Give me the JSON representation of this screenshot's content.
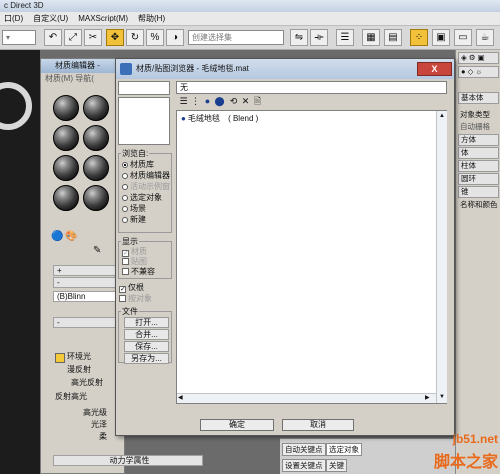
{
  "app": {
    "title": "c Direct 3D"
  },
  "menubar": [
    "口(D)",
    "自定义(U)",
    "MAXScript(M)",
    "帮助(H)"
  ],
  "toolbar": {
    "selection_set_placeholder": "创建选择集"
  },
  "right_panel": {
    "header": "基本体",
    "object_type": "对象类型",
    "auto_grid": "自动栅格",
    "items": [
      "方体",
      "体",
      "柱体",
      "圆环",
      "锥"
    ],
    "name_color": "名称和颜色"
  },
  "bottom": {
    "auto_key": "自动关键点",
    "selected": "选定对象",
    "set_key": "设置关键点",
    "key_filter": "关键"
  },
  "material_editor": {
    "title": "材质编辑器 -",
    "menu": "材质(M)  导航(",
    "shader": "(B)Blinn",
    "ambient": "环境光",
    "diffuse": "漫反射",
    "specular": "高光反射",
    "reflect_hl": "反射高光",
    "spec_level": "高光级",
    "gloss": "光泽",
    "soften": "柔",
    "dynamics": "动力学属性"
  },
  "browser": {
    "title": "材质/贴图浏览器 - 毛绒地毯.mat",
    "close": "X",
    "filter_value": "无",
    "browse_from": {
      "label": "浏览自:",
      "options": [
        {
          "label": "材质库",
          "selected": true,
          "enabled": true
        },
        {
          "label": "材质编辑器",
          "selected": false,
          "enabled": true
        },
        {
          "label": "活动示例窗",
          "selected": false,
          "enabled": false
        },
        {
          "label": "选定对象",
          "selected": false,
          "enabled": true
        },
        {
          "label": "场景",
          "selected": false,
          "enabled": true
        },
        {
          "label": "新建",
          "selected": false,
          "enabled": true
        }
      ]
    },
    "show": {
      "label": "显示",
      "options": [
        {
          "label": "材质",
          "checked": true,
          "enabled": false
        },
        {
          "label": "贴图",
          "checked": false,
          "enabled": false
        },
        {
          "label": "不兼容",
          "checked": false,
          "enabled": true
        }
      ]
    },
    "root_only": {
      "label": "仅根",
      "checked": true
    },
    "by_object": {
      "label": "按对象",
      "checked": false
    },
    "file": {
      "label": "文件",
      "buttons": [
        "打开...",
        "合并...",
        "保存...",
        "另存为..."
      ]
    },
    "list_items": [
      {
        "name": "毛绒地毯",
        "type": "( Blend )"
      }
    ],
    "ok": "确定",
    "cancel": "取消"
  },
  "watermark": {
    "site": "jb51.net",
    "name": "脚本之家"
  }
}
